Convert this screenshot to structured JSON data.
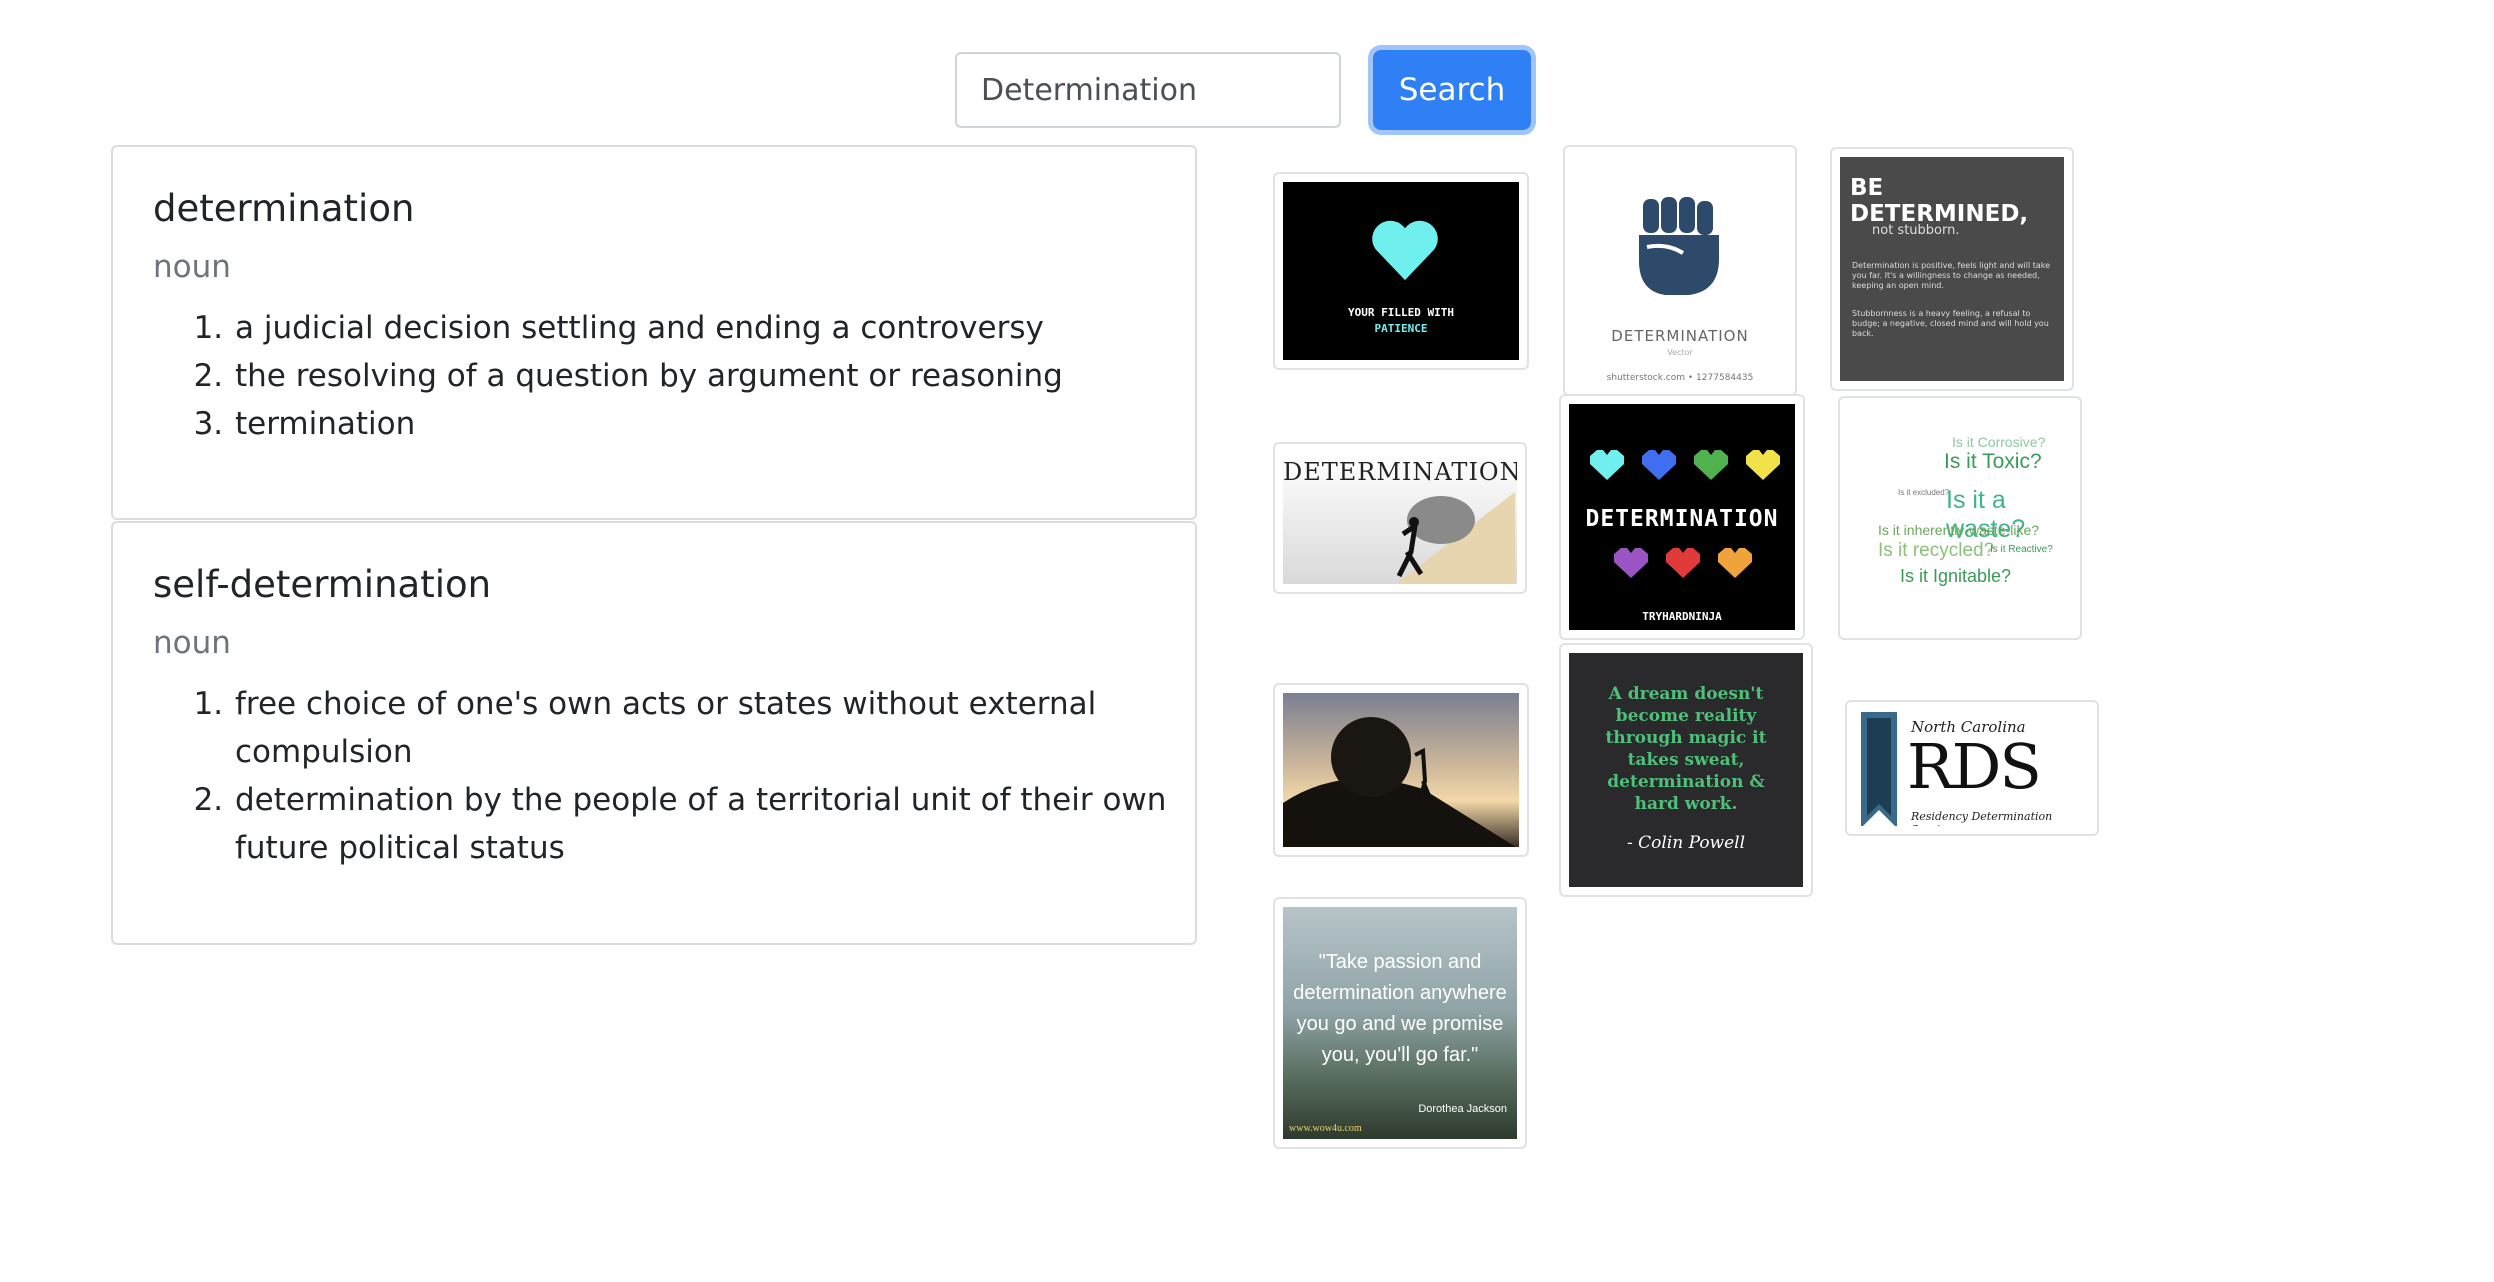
{
  "search": {
    "value": "Determination",
    "button_label": "Search"
  },
  "definitions": [
    {
      "word": "determination",
      "pos": "noun",
      "defs": [
        "a judicial decision settling and ending a controversy",
        "the resolving of a question by argument or reasoning",
        "termination"
      ]
    },
    {
      "word": "self-determination",
      "pos": "noun",
      "defs": [
        "free choice of one's own acts or states without external compulsion",
        "determination by the people of a territorial unit of their own future political status"
      ]
    }
  ],
  "images": {
    "heart_patience": {
      "line1": "YOUR FILLED WITH",
      "line2": "PATIENCE",
      "heart_color": "#6ff0ee"
    },
    "fist": {
      "caption": "DETERMINATION",
      "sub": "Vector",
      "footer": "shutterstock.com • 1277584435",
      "fist_color": "#2e4a6b"
    },
    "be_determined": {
      "title": "BE DETERMINED,",
      "subtitle": "not stubborn.",
      "para1": "Determination is positive, feels light and will take you far. It's a willingness to change as needed, keeping an open mind.",
      "para2": "Stubbornness is a heavy feeling, a refusal to budge; a negative, closed mind and will hold you back."
    },
    "sisyphus_banner": {
      "caption": "DETERMINATION"
    },
    "pixel_hearts": {
      "caption": "DETERMINATION",
      "footer": "TRYHARDNINJA",
      "colors": [
        "#6ff0ee",
        "#3f6ff0",
        "#4fb24f",
        "#f2e24a",
        "#9b54c4",
        "#e03a3a",
        "#f0a33a"
      ]
    },
    "waste_cloud": {
      "w1": "Is it Corrosive?",
      "w2": "Is it Toxic?",
      "w3": "Is it a waste?",
      "w4": "Is it inherently-waste-like?",
      "w5": "Is it recycled?",
      "w6": "Is it Reactive?",
      "w7": "Is it Ignitable?",
      "w8": "Is it excluded?"
    },
    "sunset_boulder": {},
    "powell_quote": {
      "quote": "A dream doesn't become reality through magic it takes sweat, determination & hard work.",
      "author": "- Colin Powell"
    },
    "rds_logo": {
      "state": "North Carolina",
      "acronym": "RDS",
      "full": "Residency Determination Service"
    },
    "passion_quote": {
      "quote": "\"Take passion and determination anywhere you go and we promise you, you'll go far.\"",
      "author": "Dorothea Jackson",
      "site": "www.wow4u.com"
    }
  }
}
